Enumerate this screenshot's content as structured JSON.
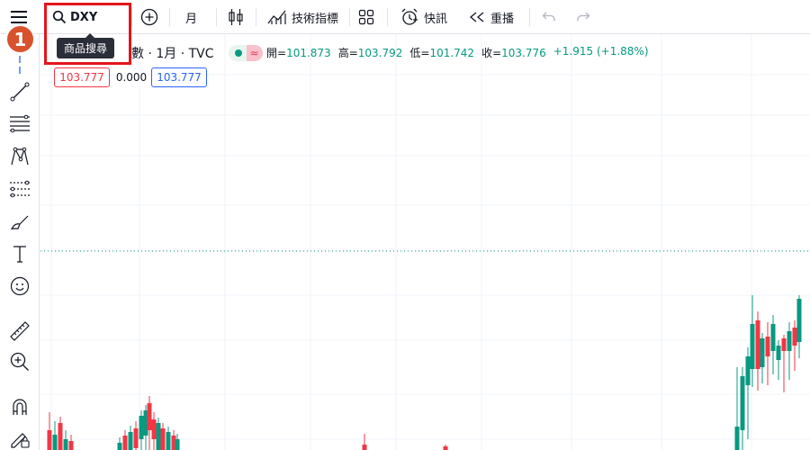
{
  "toolbar": {
    "symbol": "DXY",
    "search_tooltip": "商品搜尋",
    "interval": "月",
    "indicators_label": "技術指標",
    "alert_label": "快訊",
    "replay_label": "重播"
  },
  "step_badge": "1",
  "legend": {
    "title": "數 · 1月 · TVC",
    "open_label": "開=",
    "open": "101.873",
    "high_label": "高=",
    "high": "103.792",
    "low_label": "低=",
    "low": "101.742",
    "close_label": "收=",
    "close": "103.776",
    "change": "+1.915 (+1.88%)",
    "bid": "103.777",
    "spread": "0.000",
    "ask": "103.777"
  },
  "colors": {
    "up": "#089981",
    "down": "#f23645",
    "highlight": "#e3151a",
    "badge": "#d9522e"
  },
  "left_tools": [
    "crosshair-icon",
    "trend-line-icon",
    "fib-levels-icon",
    "pattern-icon",
    "forecast-icon",
    "brush-icon",
    "text-icon",
    "emoji-icon",
    "ruler-icon",
    "zoom-in-icon",
    "magnet-icon",
    "lock-draw-icon"
  ]
}
